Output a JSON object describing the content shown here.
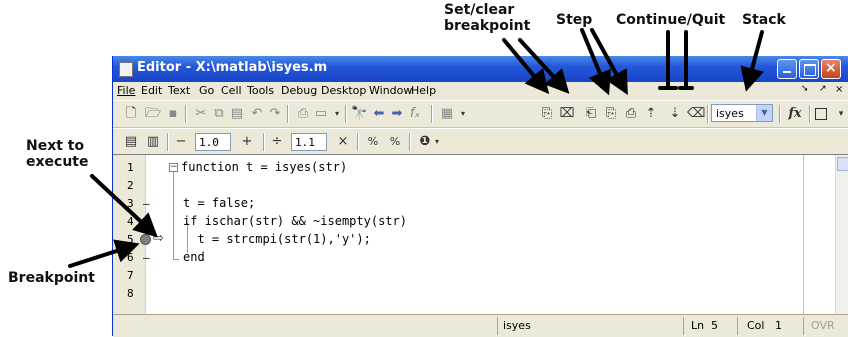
{
  "annotations": {
    "set_clear_breakpoint": [
      "Set/clear",
      "breakpoint"
    ],
    "step": "Step",
    "continue_quit": "Continue/Quit",
    "stack": "Stack",
    "next_to_execute": [
      "Next to",
      "execute"
    ],
    "breakpoint": "Breakpoint"
  },
  "window": {
    "title": "Editor - X:\\matlab\\isyes.m"
  },
  "menu": [
    "File",
    "Edit",
    "Text",
    "Go",
    "Cell",
    "Tools",
    "Debug",
    "Desktop",
    "Window",
    "Help"
  ],
  "toolbar2": {
    "minus": "−",
    "value1": "1.0",
    "plus": "+",
    "divide": "÷",
    "value2": "1.1",
    "times": "×"
  },
  "stack_select": {
    "value": "isyes"
  },
  "fx_label": "fx",
  "code": {
    "line_numbers": [
      "1",
      "2",
      "3",
      "4",
      "5",
      "6",
      "7",
      "8"
    ],
    "lines": [
      "function t = isyes(str)",
      "",
      "t = false;",
      "if ischar(str) && ~isempty(str)",
      "  t = strcmpi(str(1),'y');",
      "end",
      "",
      ""
    ]
  },
  "status": {
    "function": "isyes",
    "ln_label": "Ln",
    "ln_value": "5",
    "col_label": "Col",
    "col_value": "1",
    "ovr": "OVR"
  },
  "colors": {
    "titlebar": "#2458d8",
    "chrome": "#ece9d8",
    "breakpoint": "#808080"
  }
}
